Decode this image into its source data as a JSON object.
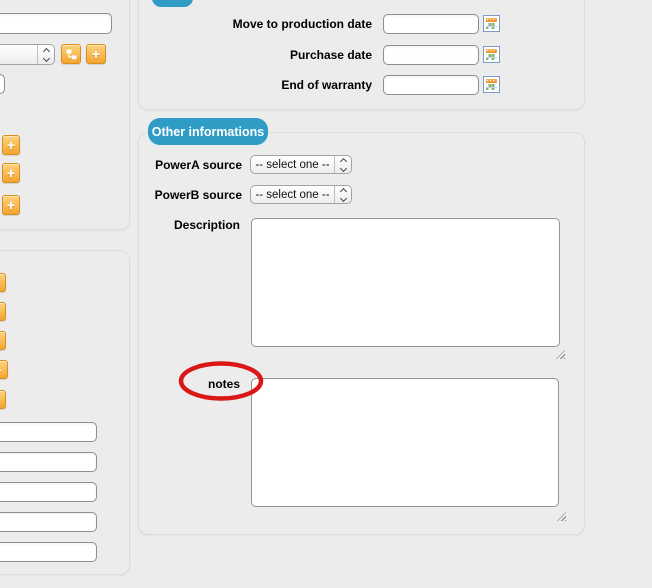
{
  "colors": {
    "page_bg": "#ececec",
    "panel_border": "#dcdcdc",
    "tab_blue": "#2f9cc5",
    "orange_button": "#f3a52f",
    "red_annotation": "#db1616",
    "calendar_frame_blue": "#7b9cc9",
    "calendar_header_orange": "#f4a140",
    "calendar_cell_green": "#83bb55"
  },
  "icons": {
    "plus": "+",
    "tree": "hierarchy-tree",
    "calendar": "calendar-grid",
    "select_chevrons": "up-down-chevrons",
    "resize": "diagonal-grip"
  },
  "sidebar": {
    "plus_label": "+"
  },
  "dates_panel": {
    "rows": [
      {
        "label": "Move to production date",
        "value": ""
      },
      {
        "label": "Purchase date",
        "value": ""
      },
      {
        "label": "End of warranty",
        "value": ""
      }
    ]
  },
  "other_panel": {
    "tab_label": "Other informations",
    "selects": [
      {
        "label": "PowerA source",
        "value": "-- select one --"
      },
      {
        "label": "PowerB source",
        "value": "-- select one --"
      }
    ],
    "description_label": "Description",
    "description_value": "",
    "notes_label": "notes",
    "notes_value": ""
  }
}
